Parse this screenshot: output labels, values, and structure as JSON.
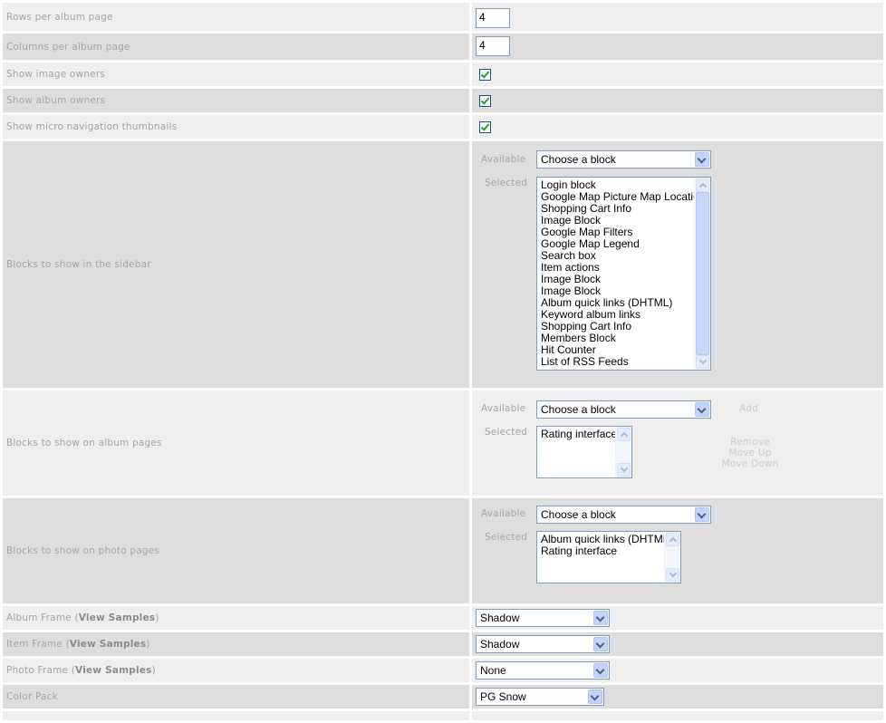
{
  "rows": {
    "rows_per_page": {
      "label": "Rows per album page",
      "value": "4"
    },
    "cols_per_page": {
      "label": "Columns per album page",
      "value": "4"
    },
    "show_image_owners": {
      "label": "Show image owners",
      "checked": true
    },
    "show_album_owners": {
      "label": "Show album owners",
      "checked": true
    },
    "show_micro_nav": {
      "label": "Show micro navigation thumbnails",
      "checked": true
    }
  },
  "sidebar_blocks": {
    "label": "Blocks to show in the sidebar",
    "available_label": "Available",
    "selected_label": "Selected",
    "available_value": "Choose a block",
    "selected": [
      "Login block",
      "Google Map Picture Map Location",
      "Shopping Cart Info",
      "Image Block",
      "Google Map Filters",
      "Google Map Legend",
      "Search box",
      "Item actions",
      "Image Block",
      "Image Block",
      "Album quick links (DHTML)",
      "Keyword album links",
      "Shopping Cart Info",
      "Members Block",
      "Hit Counter",
      "List of RSS Feeds"
    ]
  },
  "album_blocks": {
    "label": "Blocks to show on album pages",
    "available_label": "Available",
    "selected_label": "Selected",
    "available_value": "Choose a block",
    "selected": [
      "Rating interface"
    ],
    "add_label": "Add",
    "remove_label": "Remove",
    "move_up_label": "Move Up",
    "move_down_label": "Move Down"
  },
  "photo_blocks": {
    "label": "Blocks to show on photo pages",
    "available_label": "Available",
    "selected_label": "Selected",
    "available_value": "Choose a block",
    "selected": [
      "Album quick links (DHTML)",
      "Rating interface"
    ]
  },
  "frames": {
    "album_frame": {
      "label": "Album Frame (",
      "link": "View Samples",
      "suffix": ")",
      "value": "Shadow"
    },
    "item_frame": {
      "label": "Item Frame (",
      "link": "View Samples",
      "suffix": ")",
      "value": "Shadow"
    },
    "photo_frame": {
      "label": "Photo Frame (",
      "link": "View Samples",
      "suffix": ")",
      "value": "None"
    },
    "color_pack": {
      "label": "Color Pack",
      "value": "PG Snow"
    }
  },
  "colors": {
    "row_light": "#eeeeee",
    "row_dark": "#dddddd",
    "label_text": "#a6a6a6",
    "field_border": "#7f9db9",
    "check_green": "#21a121"
  },
  "icons": {
    "dropdown": "chevron-down-icon",
    "checkbox": "checkmark-icon",
    "scroll": "scroll-arrow-icon"
  }
}
